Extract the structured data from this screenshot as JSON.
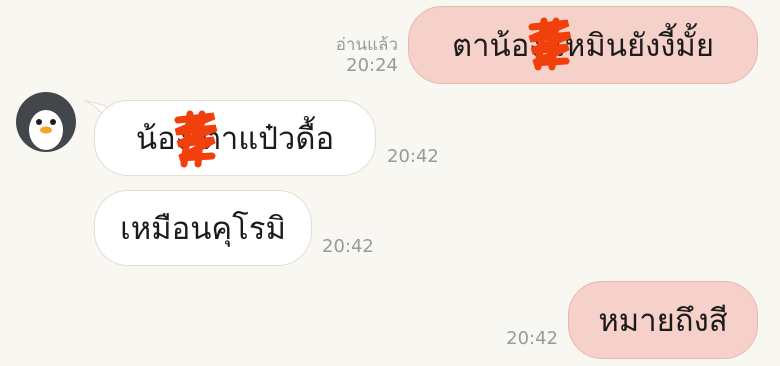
{
  "chat": {
    "messages": [
      {
        "direction": "outgoing",
        "text": "ตาน้อง    เหมินยังงี้มั้ย",
        "status": "อ่านแล้ว",
        "time": "20:24"
      },
      {
        "direction": "incoming",
        "text": "น้อง    ตาแป๋วดื้อ",
        "time": "20:42"
      },
      {
        "direction": "incoming",
        "text": "เหมือนคุโรมิ",
        "time": "20:42"
      },
      {
        "direction": "outgoing",
        "text": "หมายถึงสี",
        "time": "20:42"
      }
    ],
    "avatar": {
      "icon": "penguin-avatar-icon"
    },
    "colors": {
      "background": "#f9f7f2",
      "outgoing_bubble": "#f5d1c9",
      "incoming_bubble": "#ffffff",
      "redaction": "#f2400c",
      "timestamp": "#9a9a9a"
    }
  }
}
